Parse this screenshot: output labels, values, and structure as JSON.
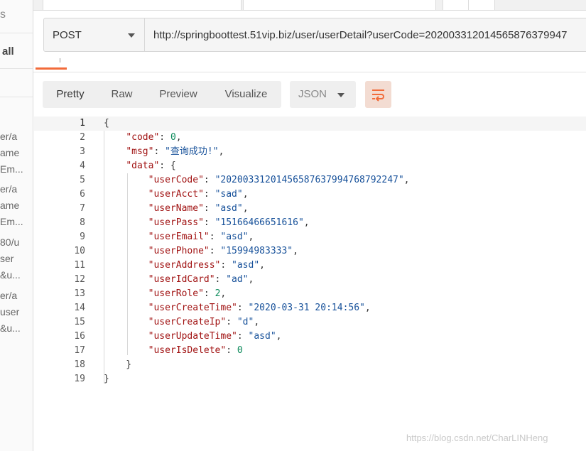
{
  "sidebar": {
    "top_glyph": "s",
    "all_label": "all",
    "entries": [
      {
        "lines": [
          "er/a",
          "ame",
          "Em..."
        ]
      },
      {
        "lines": [
          "er/a",
          "ame",
          "Em..."
        ]
      },
      {
        "lines": [
          "80/u",
          "ser",
          "&u..."
        ]
      },
      {
        "lines": [
          "er/a",
          "user",
          "&u..."
        ]
      }
    ]
  },
  "request": {
    "method": "POST",
    "url": "http://springboottest.51vip.biz/user/userDetail?userCode=202003312014565876379947"
  },
  "response": {
    "views": [
      "Pretty",
      "Raw",
      "Preview",
      "Visualize"
    ],
    "active_view": "Pretty",
    "format": "JSON",
    "wrap_icon": "wrap-lines-icon",
    "lines": [
      {
        "num": "1",
        "text": "{"
      },
      {
        "num": "2",
        "text": "    \"code\": 0,"
      },
      {
        "num": "3",
        "text": "    \"msg\": \"查询成功!\","
      },
      {
        "num": "4",
        "text": "    \"data\": {"
      },
      {
        "num": "5",
        "text": "        \"userCode\": \"20200331201456587637994768792247\","
      },
      {
        "num": "6",
        "text": "        \"userAcct\": \"sad\","
      },
      {
        "num": "7",
        "text": "        \"userName\": \"asd\","
      },
      {
        "num": "8",
        "text": "        \"userPass\": \"15166466651616\","
      },
      {
        "num": "9",
        "text": "        \"userEmail\": \"asd\","
      },
      {
        "num": "10",
        "text": "        \"userPhone\": \"15994983333\","
      },
      {
        "num": "11",
        "text": "        \"userAddress\": \"asd\","
      },
      {
        "num": "12",
        "text": "        \"userIdCard\": \"ad\","
      },
      {
        "num": "13",
        "text": "        \"userRole\": 2,"
      },
      {
        "num": "14",
        "text": "        \"userCreateTime\": \"2020-03-31 20:14:56\","
      },
      {
        "num": "15",
        "text": "        \"userCreateIp\": \"d\","
      },
      {
        "num": "16",
        "text": "        \"userUpdateTime\": \"asd\","
      },
      {
        "num": "17",
        "text": "        \"userIsDelete\": 0"
      },
      {
        "num": "18",
        "text": "    }"
      },
      {
        "num": "19",
        "text": "}"
      }
    ]
  },
  "watermark": "https://blog.csdn.net/CharLINHeng",
  "colors": {
    "accent": "#f26b3a",
    "json_key": "#a11313",
    "json_string": "#17519a",
    "json_number": "#0b8a5a"
  }
}
